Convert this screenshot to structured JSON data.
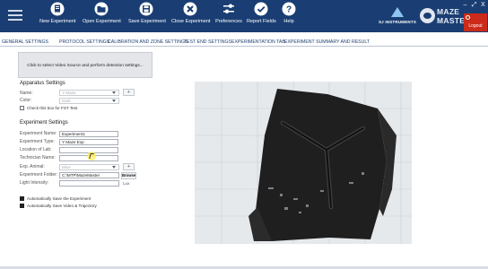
{
  "toolbar": {
    "items": [
      {
        "label": "New Experiment",
        "icon": "new-experiment-icon"
      },
      {
        "label": "Open Experiment",
        "icon": "folder-icon"
      },
      {
        "label": "Save Experiment",
        "icon": "save-icon"
      },
      {
        "label": "Close Experiment",
        "icon": "close-circle-icon"
      },
      {
        "label": "Preferences",
        "icon": "sliders-icon"
      },
      {
        "label": "Report Fields",
        "icon": "checklist-icon"
      },
      {
        "label": "Help",
        "icon": "help-icon"
      }
    ]
  },
  "brand": {
    "left_text": "SJ INSTRUMENTS",
    "right_line1": "MAZE",
    "right_line2": "MASTER"
  },
  "window": {
    "minimize": "–",
    "restore": "⤢",
    "close": "X",
    "logout_label": "Logout"
  },
  "tabs": [
    {
      "label": "GENERAL SETTINGS",
      "active": true
    },
    {
      "label": "PROTOCOL SETTINGS",
      "active": false
    },
    {
      "label": "CALIBRATION AND ZONE SETTINGS",
      "active": false
    },
    {
      "label": "TEST END SETTINGS",
      "active": false
    },
    {
      "label": "EXPERIMENTATION TAB",
      "active": false
    },
    {
      "label": "EXPERIMENT SUMMARY AND RESULT",
      "active": false
    }
  ],
  "left_panel": {
    "video_source_button": "Click to select Video Source and perform detection settings...",
    "apparatus": {
      "title": "Apparatus Settings",
      "name_label": "Name:",
      "name_value": "Y Maze",
      "color_label": "Color:",
      "color_value": "Dark",
      "ftt_label": "Check this box for FST Test",
      "add_label": "+"
    },
    "experiment": {
      "title": "Experiment Settings",
      "name_label": "Experiment Name:",
      "name_value": "Experiment1",
      "type_label": "Experiment Type:",
      "type_value": "Y Maze Exp",
      "location_label": "Location of Lab:",
      "location_value": "",
      "technician_label": "Technician Name:",
      "technician_value": "",
      "animal_label": "Exp. Animal:",
      "animal_value": "Mice",
      "folder_label": "Experiment Folder:",
      "folder_value": "C:\\MTP\\MazeMaster",
      "browse_label": "Browse",
      "light_label": "Light Intensity:",
      "light_value": "",
      "light_unit": "Lux",
      "add_label": "+"
    },
    "auto_save_experiment": "Automatically Save the Experiment",
    "auto_save_video": "Automatically Save Video & Trajectory"
  },
  "colors": {
    "toolbar_bg": "#1a3e73",
    "logout_bg": "#cc2a1a",
    "tab_text": "#1e3f70"
  }
}
